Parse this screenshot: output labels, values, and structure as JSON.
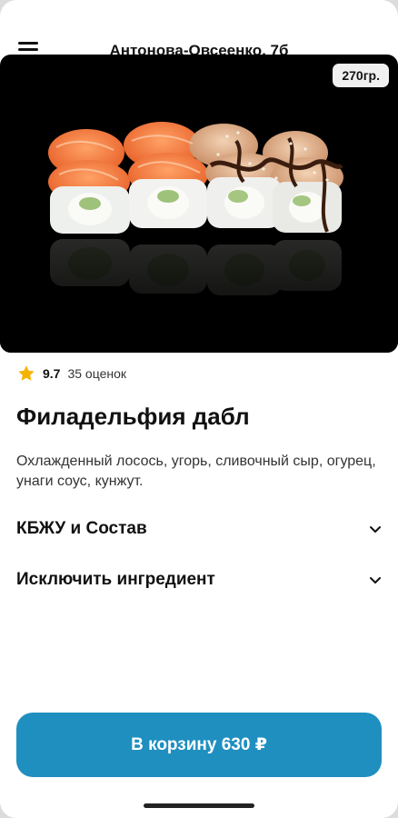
{
  "header": {
    "address": "Антонова-Овсеенко, 7б"
  },
  "product": {
    "weight": "270гр.",
    "rating": "9.7",
    "ratings_count": "35 оценок",
    "title": "Филадельфия дабл",
    "description": "Охлажденный лосось, угорь, сливочный сыр, огурец, унаги соус, кунжут."
  },
  "sections": [
    {
      "label": "КБЖУ и Состав"
    },
    {
      "label": "Исключить ингредиент"
    }
  ],
  "cart": {
    "button_label": "В корзину 630 ₽"
  },
  "colors": {
    "accent": "#1f8fc0",
    "star": "#f5b301"
  }
}
